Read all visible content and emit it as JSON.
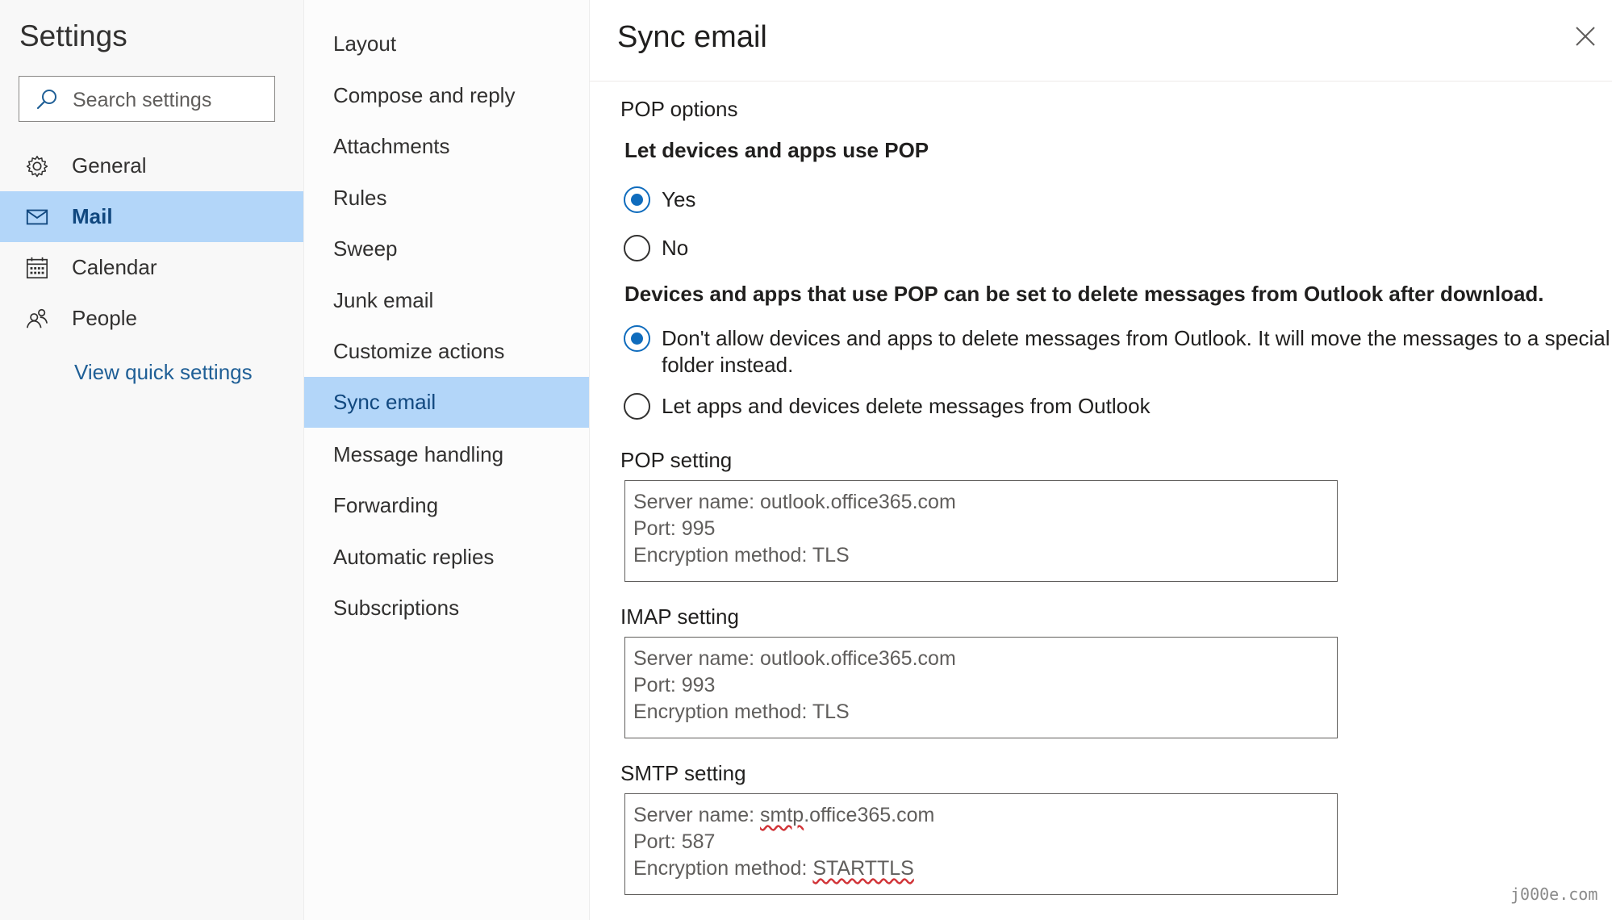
{
  "nav": {
    "title": "Settings",
    "search_placeholder": "Search settings",
    "items": [
      {
        "label": "General",
        "icon": "gear-icon"
      },
      {
        "label": "Mail",
        "icon": "mail-icon",
        "selected": true
      },
      {
        "label": "Calendar",
        "icon": "calendar-icon"
      },
      {
        "label": "People",
        "icon": "people-icon"
      }
    ],
    "quick_settings_link": "View quick settings"
  },
  "subnav": {
    "items": [
      {
        "label": "Layout"
      },
      {
        "label": "Compose and reply"
      },
      {
        "label": "Attachments"
      },
      {
        "label": "Rules"
      },
      {
        "label": "Sweep"
      },
      {
        "label": "Junk email"
      },
      {
        "label": "Customize actions"
      },
      {
        "label": "Sync email",
        "selected": true
      },
      {
        "label": "Message handling"
      },
      {
        "label": "Forwarding"
      },
      {
        "label": "Automatic replies"
      },
      {
        "label": "Subscriptions"
      }
    ]
  },
  "content": {
    "title": "Sync email",
    "close_icon": "close-icon",
    "pop_options_label": "POP options",
    "pop_question": "Let devices and apps use POP",
    "pop_yes": "Yes",
    "pop_no": "No",
    "pop_yes_selected": true,
    "delete_question": "Devices and apps that use POP can be set to delete messages from Outlook after download.",
    "delete_option_dont_allow_line1": "Don't allow devices and apps to delete messages from Outlook. It will move the messages to a special POP",
    "delete_option_dont_allow_line2": "folder instead.",
    "delete_option_allow": "Let apps and devices delete messages from Outlook",
    "delete_dont_allow_selected": true,
    "pop_setting": {
      "label": "POP setting",
      "server_prefix": "Server name: ",
      "server": "outlook.office365.com",
      "port": "Port: 995",
      "encryption": "Encryption method: TLS"
    },
    "imap_setting": {
      "label": "IMAP setting",
      "server_prefix": "Server name: ",
      "server": "outlook.office365.com",
      "port": "Port: 993",
      "encryption": "Encryption method: TLS"
    },
    "smtp_setting": {
      "label": "SMTP setting",
      "server_prefix": "Server name: ",
      "server_misspelled": "smtp",
      "server_rest": ".office365.com",
      "port": "Port: 587",
      "encryption_prefix": "Encryption method: ",
      "encryption_misspelled": "STARTTLS"
    }
  },
  "watermark": "j000e.com",
  "colors": {
    "selected_bg": "#b3d6f9",
    "selected_text": "#11487f",
    "radio_accent": "#0f6cbd",
    "link": "#1f5f96"
  }
}
